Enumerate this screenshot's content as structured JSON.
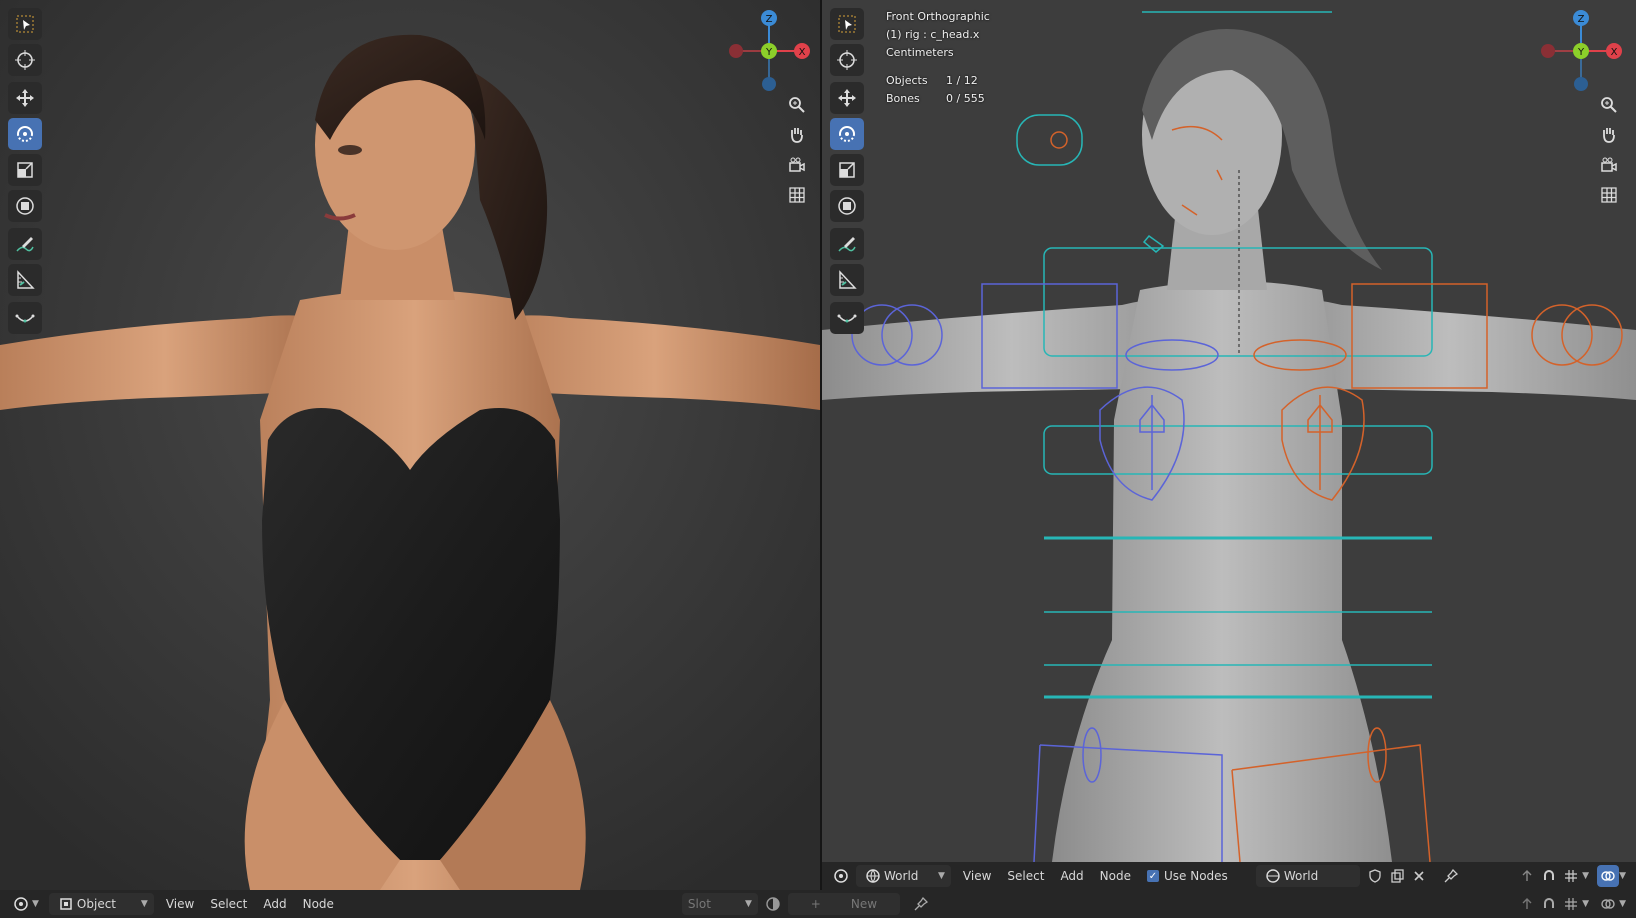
{
  "left_viewport": {
    "header": {
      "mode_label": "Object",
      "menu": [
        "View",
        "Select",
        "Add",
        "Node"
      ],
      "slot_label": "Slot",
      "new_label": "New"
    }
  },
  "right_viewport": {
    "overlay": {
      "view_name": "Front Orthographic",
      "active_object": "(1) rig : c_head.x",
      "units": "Centimeters",
      "objects_label": "Objects",
      "objects_value": "1 / 12",
      "bones_label": "Bones",
      "bones_value": "0 / 555"
    },
    "header": {
      "world_label": "World",
      "menu": [
        "View",
        "Select",
        "Add",
        "Node"
      ],
      "use_nodes_label": "Use Nodes",
      "use_nodes_checked": true,
      "world_datablock": "World"
    }
  },
  "gizmo": {
    "z_label": "Z",
    "y_label": "Y",
    "x_label": "X"
  },
  "icons": {
    "toolbar": [
      "select-box-icon",
      "cursor-icon",
      "move-icon",
      "rotate-icon",
      "scale-icon",
      "transform-icon",
      "annotate-icon",
      "measure-icon",
      "bone-curve-icon"
    ],
    "navigation": [
      "zoom-icon",
      "pan-hand-icon",
      "camera-icon",
      "grid-icon"
    ]
  },
  "colors": {
    "accent": "#4772b3",
    "axis_x": "#e0414a",
    "axis_y": "#8ccf2a",
    "axis_z": "#3b8bd6",
    "rig_cyan": "#27b6b6",
    "rig_blue": "#5b64d8",
    "rig_orange": "#d4622a"
  }
}
